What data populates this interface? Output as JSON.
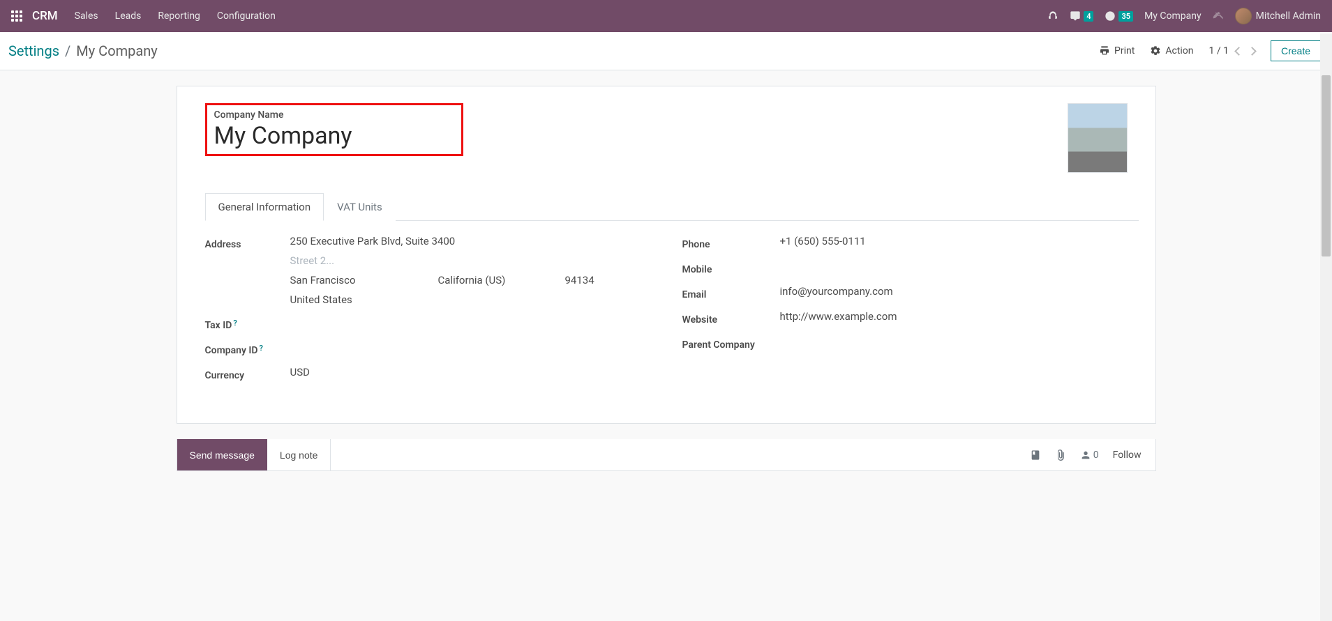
{
  "navbar": {
    "brand": "CRM",
    "menu": [
      "Sales",
      "Leads",
      "Reporting",
      "Configuration"
    ],
    "messages_badge": "4",
    "activities_badge": "35",
    "company_label": "My Company",
    "user_name": "Mitchell Admin"
  },
  "breadcrumb": {
    "parent": "Settings",
    "current": "My Company"
  },
  "actions": {
    "print": "Print",
    "action": "Action",
    "pager": "1 / 1",
    "create": "Create"
  },
  "company": {
    "name_label": "Company Name",
    "name": "My Company"
  },
  "tabs": {
    "general": "General Information",
    "vat": "VAT Units"
  },
  "fields": {
    "address_label": "Address",
    "address_line1": "250 Executive Park Blvd, Suite 3400",
    "street2_placeholder": "Street 2...",
    "city": "San Francisco",
    "state": "California (US)",
    "zip": "94134",
    "country": "United States",
    "taxid_label": "Tax ID",
    "companyid_label": "Company ID",
    "currency_label": "Currency",
    "currency": "USD",
    "phone_label": "Phone",
    "phone": "+1 (650) 555-0111",
    "mobile_label": "Mobile",
    "email_label": "Email",
    "email": "info@yourcompany.com",
    "website_label": "Website",
    "website": "http://www.example.com",
    "parent_company_label": "Parent Company"
  },
  "chatter": {
    "send": "Send message",
    "lognote": "Log note",
    "follow": "Follow",
    "followers": "0"
  }
}
